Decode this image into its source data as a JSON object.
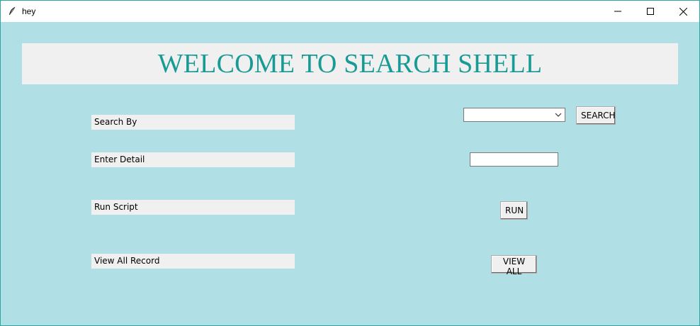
{
  "window": {
    "title": "hey",
    "icon": "feather-icon",
    "controls": [
      "minimize-icon",
      "maximize-icon",
      "close-icon"
    ]
  },
  "banner": {
    "title": "WELCOME TO SEARCH SHELL",
    "color": "#189b94",
    "background": "#f0f0f0"
  },
  "labels": {
    "search_by": "Search By",
    "enter_detail": "Enter Detail",
    "run_script": "Run Script",
    "view_all_record": "View All Record"
  },
  "search_by_select": {
    "value": ""
  },
  "detail_input": {
    "value": ""
  },
  "buttons": {
    "search": "SEARCH",
    "run": "RUN",
    "view_all": "VIEW ALL"
  },
  "colors": {
    "background": "#b0dfe5",
    "accent": "#189b94"
  }
}
